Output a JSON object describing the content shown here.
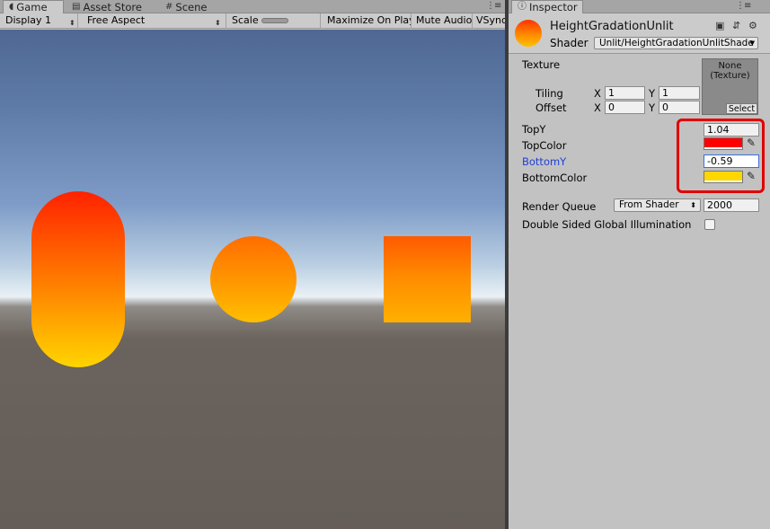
{
  "game_panel": {
    "tabs": [
      {
        "label": "Game",
        "icon": "gamepad-icon"
      },
      {
        "label": "Asset Store",
        "icon": "store-icon"
      },
      {
        "label": "Scene",
        "icon": "grid-icon"
      }
    ],
    "toolbar": {
      "display": "Display 1",
      "aspect": "Free Aspect",
      "scale_label": "Scale",
      "scale_value": "1x",
      "maximize": "Maximize On Play",
      "mute": "Mute Audio",
      "vsync": "VSync"
    },
    "scene": {
      "sky_colors": [
        "#4f6893",
        "#b9cee2",
        "#eaf1f6"
      ],
      "ground_color": "#645d58",
      "objects": [
        "capsule",
        "sphere",
        "cube"
      ]
    }
  },
  "inspector": {
    "tab_label": "Inspector",
    "material_name": "HeightGradationUnlit",
    "shader_label": "Shader",
    "shader_value": "Unlit/HeightGradationUnlitShade",
    "texture": {
      "label": "Texture",
      "preview_text": "None\n(Texture)",
      "select_label": "Select",
      "tiling_label": "Tiling",
      "offset_label": "Offset",
      "tiling_x": "1",
      "tiling_y": "1",
      "offset_x": "0",
      "offset_y": "0",
      "x_label": "X",
      "y_label": "Y"
    },
    "properties": {
      "top_y_label": "TopY",
      "top_y_value": "1.04",
      "top_color_label": "TopColor",
      "top_color": "#ff0000",
      "bottom_y_label": "BottomY",
      "bottom_y_value": "-0.59",
      "bottom_color_label": "BottomColor",
      "bottom_color": "#ffd700"
    },
    "render_queue": {
      "label": "Render Queue",
      "mode": "From Shader",
      "value": "2000"
    },
    "double_sided_gi": {
      "label": "Double Sided Global Illumination",
      "checked": false
    },
    "highlight_color": "#e00000"
  }
}
